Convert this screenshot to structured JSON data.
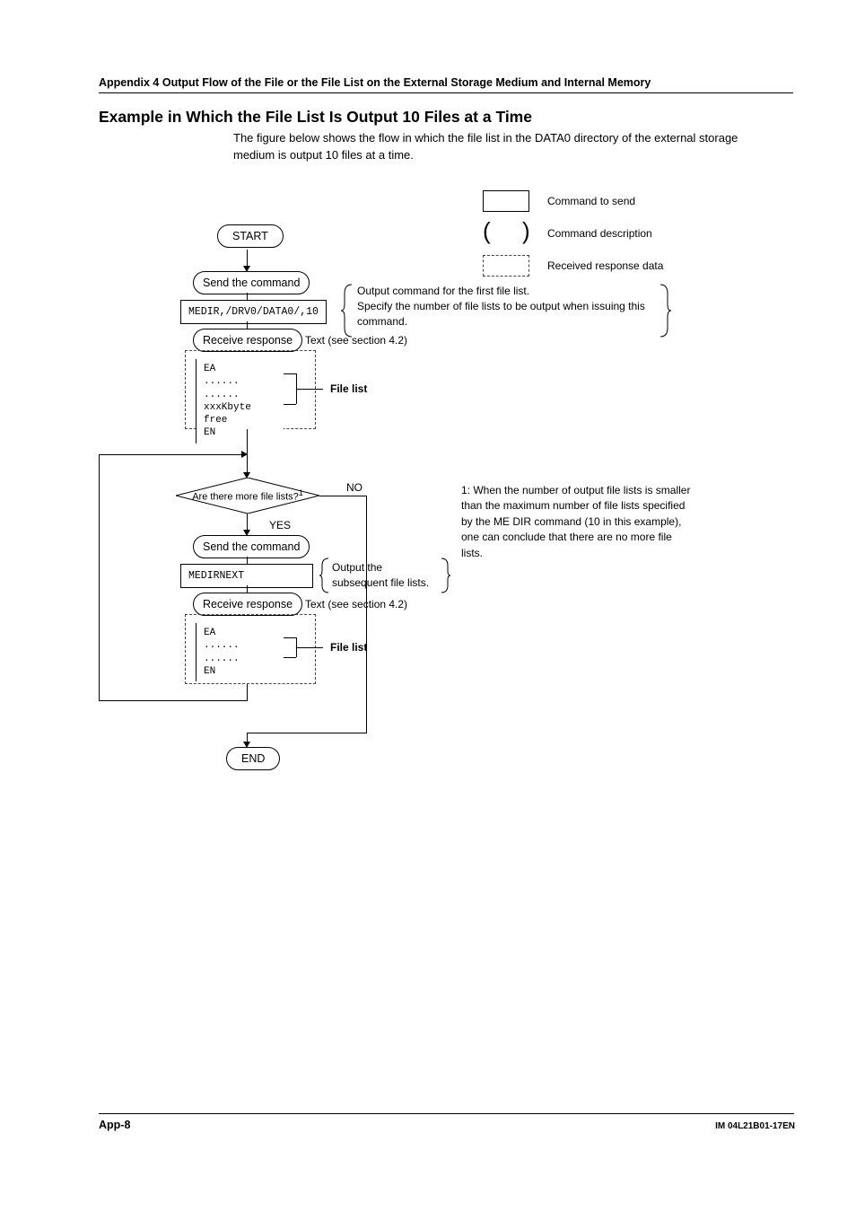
{
  "header": "Appendix 4  Output Flow of the File or the File List on the External Storage Medium and Internal Memory",
  "section_title": "Example in Which the File List Is Output 10 Files at a Time",
  "intro": "The figure below shows the flow in which the file list in the DATA0 directory of the external storage medium is output 10 files at a time.",
  "legend": {
    "command_to_send": "Command to send",
    "command_description": "Command description",
    "received_response": "Received response data"
  },
  "flow": {
    "start": "START",
    "end": "END",
    "send_command": "Send the command",
    "receive_response": "Receive response",
    "text_ref": "Text (see section 4.2)",
    "cmd1": "MEDIR,/DRV0/DATA0/,10",
    "cmd1_note": "Output command for the first file list.\nSpecify the number of file lists to be output when issuing this command.",
    "response1": {
      "lines": [
        "EA",
        "......",
        "......",
        "xxxKbyte free",
        "EN"
      ],
      "label": "File list"
    },
    "decision": "Are there more file lists?",
    "decision_sup": "1",
    "no": "NO",
    "yes": "YES",
    "footnote1": "1: When the number of output file lists is smaller than the maximum number of file lists specified by the ME DIR command (10 in this example), one can conclude that there are no more file lists.",
    "cmd2": "MEDIRNEXT",
    "cmd2_note": "Output the\nsubsequent file lists.",
    "response2": {
      "lines": [
        "EA",
        "......",
        "......",
        "EN"
      ],
      "label": "File list"
    }
  },
  "footer": {
    "left": "App-8",
    "right": "IM 04L21B01-17EN"
  }
}
